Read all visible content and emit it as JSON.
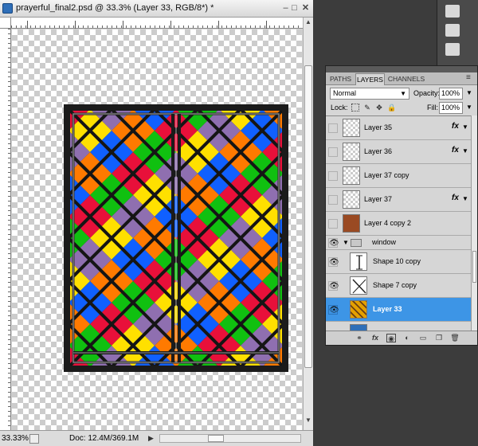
{
  "document": {
    "title": "prayerful_final2.psd @ 33.3% (Layer 33, RGB/8*) *",
    "minimize": "–",
    "maximize": "□",
    "close": "✕",
    "zoom": "33.33%",
    "doc_size": "Doc: 12.4M/369.1M",
    "status_arrow": "▶",
    "scroll_up": "▲",
    "scroll_down": "▼"
  },
  "layers_panel": {
    "tabs": [
      "PATHS",
      "LAYERS",
      "CHANNELS"
    ],
    "menu_icon": "≡",
    "blend_mode": "Normal",
    "opacity_label": "Opacity:",
    "opacity_value": "100%",
    "lock_label": "Lock:",
    "fill_label": "Fill:",
    "fill_value": "100%",
    "dropdown_arrow": "▼",
    "eye_glyph": "👁",
    "fx_label": "fx",
    "group_arrow": "▼",
    "layers": [
      {
        "name": "Layer 35",
        "visible": false,
        "fx": true,
        "thumb": "transparent"
      },
      {
        "name": "Layer 36",
        "visible": false,
        "fx": true,
        "thumb": "transparent"
      },
      {
        "name": "Layer 37 copy",
        "visible": false,
        "fx": false,
        "thumb": "transparent"
      },
      {
        "name": "Layer 37",
        "visible": false,
        "fx": true,
        "thumb": "transparent"
      },
      {
        "name": "Layer 4 copy 2",
        "visible": false,
        "fx": false,
        "thumb": "brown"
      },
      {
        "name": "window",
        "visible": true,
        "group": true
      },
      {
        "name": "Shape 10 copy",
        "visible": true,
        "fx": false,
        "thumb": "shape"
      },
      {
        "name": "Shape 7 copy",
        "visible": true,
        "fx": false,
        "thumb": "shape"
      },
      {
        "name": "Layer 33",
        "visible": true,
        "fx": false,
        "thumb": "stained",
        "selected": true
      }
    ]
  },
  "colors": {
    "selection": "#3d95e6",
    "glass_red": "#e8103a",
    "glass_orange": "#ff7a00",
    "glass_yellow": "#ffe000",
    "glass_green": "#10c010",
    "glass_blue": "#1060ff",
    "glass_purple": "#8f6fb0"
  }
}
